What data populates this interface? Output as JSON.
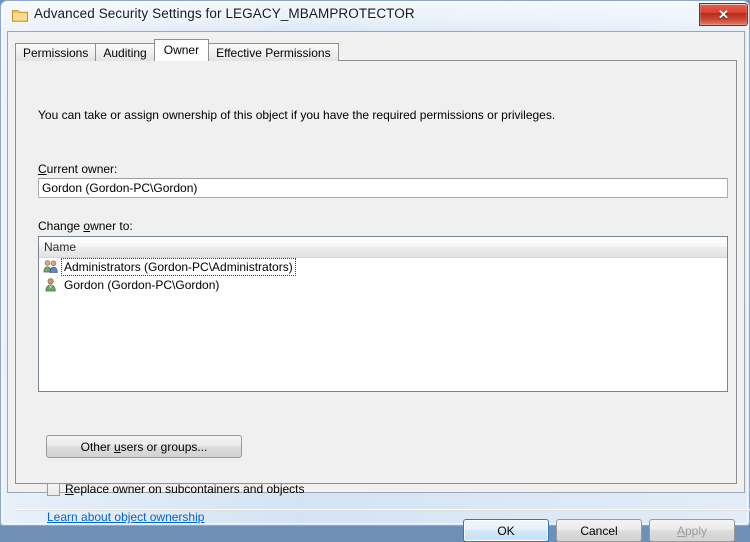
{
  "window": {
    "title": "Advanced Security Settings for LEGACY_MBAMPROTECTOR",
    "title_icon": "folder-icon",
    "close_label": "✕"
  },
  "tabs": [
    {
      "label": "Permissions",
      "active": false
    },
    {
      "label": "Auditing",
      "active": false
    },
    {
      "label": "Owner",
      "active": true
    },
    {
      "label": "Effective Permissions",
      "active": false
    }
  ],
  "owner_tab": {
    "description": "You can take or assign ownership of this object if you have the required permissions or privileges.",
    "current_owner_label": "Current owner:",
    "current_owner_accel": "C",
    "current_owner_value": "Gordon (Gordon-PC\\Gordon)",
    "change_owner_label_pre": "Change ",
    "change_owner_accel": "o",
    "change_owner_label_post": "wner to:",
    "list": {
      "column_header": "Name",
      "rows": [
        {
          "label": "Administrators (Gordon-PC\\Administrators)",
          "icon": "group-icon",
          "focused": true
        },
        {
          "label": "Gordon (Gordon-PC\\Gordon)",
          "icon": "user-icon",
          "focused": false
        }
      ]
    },
    "other_users_button_pre": "Other ",
    "other_users_button_accel": "u",
    "other_users_button_post": "sers or groups...",
    "replace_checkbox_accel": "R",
    "replace_checkbox_label": "eplace owner on subcontainers and objects",
    "replace_checkbox_checked": false,
    "learn_link": "Learn about object ownership"
  },
  "footer": {
    "ok_label": "OK",
    "cancel_label": "Cancel",
    "apply_accel": "A",
    "apply_label": "pply",
    "apply_disabled": true
  },
  "colors": {
    "link": "#0066CC",
    "default_button_border": "#2C78C6",
    "close_button": "#D7412F",
    "disabled_text": "#9B9B9B"
  }
}
